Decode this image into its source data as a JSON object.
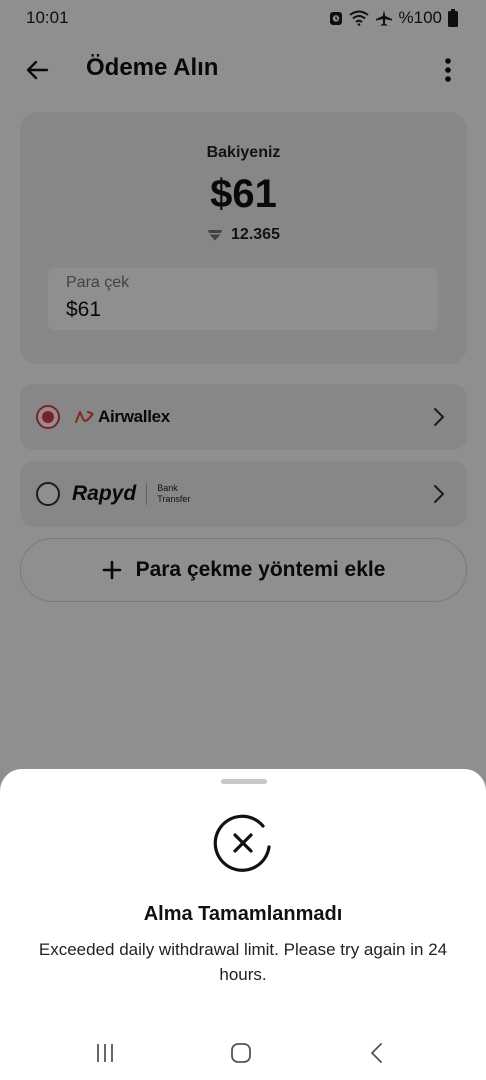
{
  "status_bar": {
    "time": "10:01",
    "battery": "%100",
    "icons": [
      "alarm-icon",
      "wifi-icon",
      "airplane-icon",
      "battery-icon"
    ]
  },
  "header": {
    "title": "Ödeme Alın",
    "back_icon": "arrow-left-icon",
    "menu_icon": "more-vertical-icon"
  },
  "balance": {
    "label": "Bakiyeniz",
    "amount": "$61",
    "points": "12.365",
    "withdraw_label": "Para çek",
    "withdraw_value": "$61"
  },
  "methods": [
    {
      "name": "Airwallex",
      "selected": true
    },
    {
      "name": "Rapyd",
      "sub_line1": "Bank",
      "sub_line2": "Transfer",
      "selected": false
    }
  ],
  "add_method": {
    "label": "Para çekme yöntemi ekle"
  },
  "sheet": {
    "title": "Alma Tamamlanmadı",
    "message": "Exceeded daily withdrawal limit. Please try again in 24 hours.",
    "icon": "error-x-icon"
  },
  "colors": {
    "accent": "#e03a4e",
    "card": "#f1f1f1",
    "overlay": "rgba(0,0,0,0.44)"
  },
  "nav_bar": {
    "icons": [
      "recents-icon",
      "home-icon",
      "back-icon"
    ]
  }
}
